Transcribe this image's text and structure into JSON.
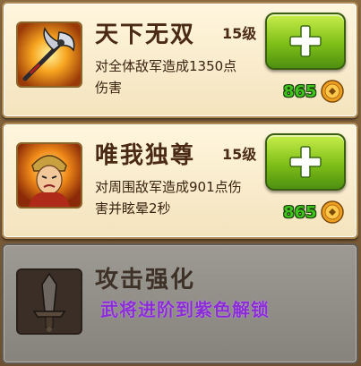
{
  "skills": [
    {
      "name": "天下无双",
      "level": "15级",
      "description": "对全体敌军造成1350点伤害",
      "cost": "865",
      "icon": "halberd-skill-icon",
      "state": "upgradable"
    },
    {
      "name": "唯我独尊",
      "level": "15级",
      "description": "对周围敌军造成901点伤害并眩晕2秒",
      "cost": "865",
      "icon": "warrior-portrait-icon",
      "state": "upgradable"
    },
    {
      "name": "攻击强化",
      "unlock_hint": "武将进阶到紫色解锁",
      "icon": "sword-skill-icon",
      "state": "locked"
    }
  ],
  "colors": {
    "card_bg": "#f8ebc9",
    "locked_bg": "#918e87",
    "upgrade_button": "#7fbf18",
    "cost_text": "#3ec41c",
    "unlock_hint": "#8a2bd6"
  },
  "icons": {
    "upgrade": "plus-icon",
    "currency": "coin-icon"
  }
}
